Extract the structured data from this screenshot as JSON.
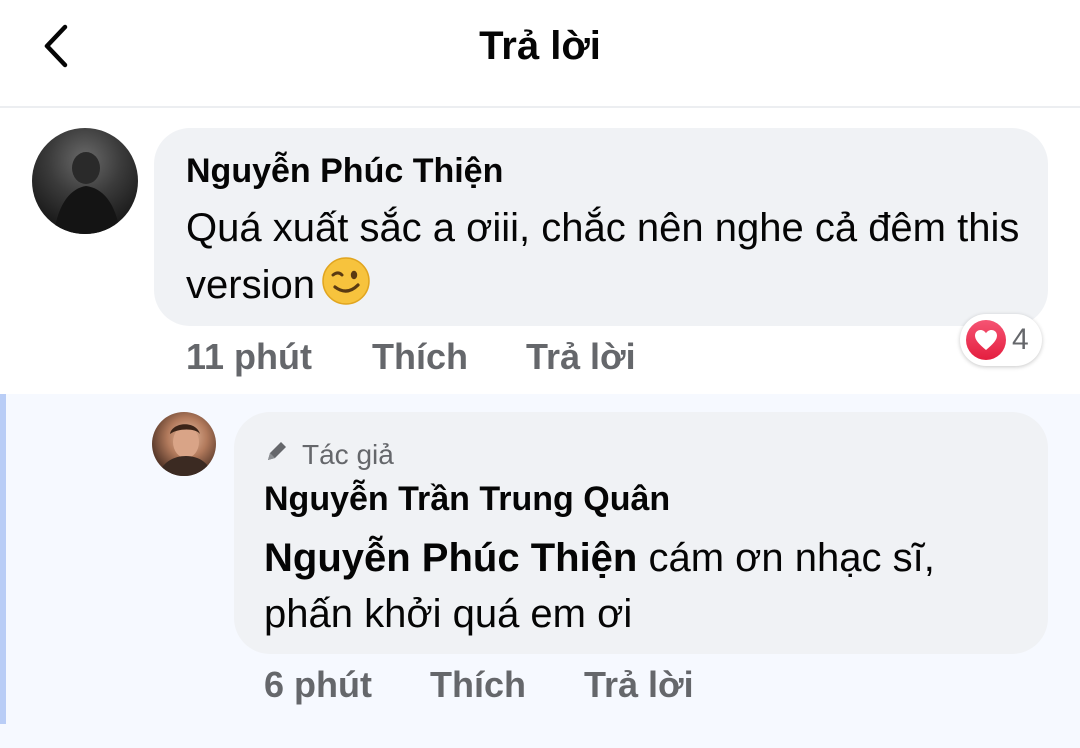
{
  "header": {
    "title": "Trả lời"
  },
  "comment": {
    "author": "Nguyễn Phúc Thiện",
    "text": "Quá xuất sắc a ơiii, chắc nên nghe cả đêm this version",
    "emoji": "winking-face",
    "time": "11 phút",
    "like_label": "Thích",
    "reply_label": "Trả lời",
    "reaction": {
      "type": "love",
      "count": "4",
      "color": "#e41e3f"
    }
  },
  "reply": {
    "badge": "Tác giả",
    "author": "Nguyễn Trần Trung Quân",
    "mention": "Nguyễn Phúc Thiện",
    "text": " cám ơn nhạc sĩ, phấn khởi quá em ơi",
    "time": "6 phút",
    "like_label": "Thích",
    "reply_label": "Trả lời"
  },
  "colors": {
    "bubble": "#f0f2f5",
    "meta": "#65676b",
    "thread_line": "#b9cdf6",
    "reply_bg": "#f6f9ff"
  }
}
